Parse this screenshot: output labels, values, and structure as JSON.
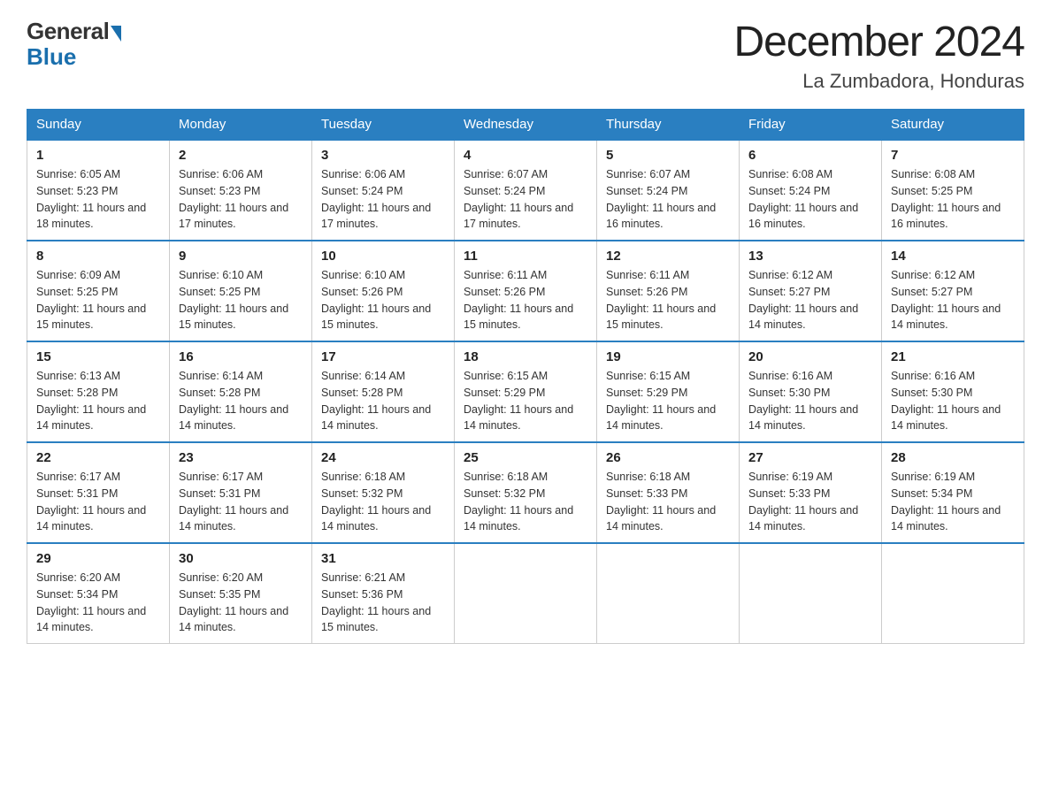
{
  "logo": {
    "general": "General",
    "blue": "Blue"
  },
  "title": "December 2024",
  "location": "La Zumbadora, Honduras",
  "days_header": [
    "Sunday",
    "Monday",
    "Tuesday",
    "Wednesday",
    "Thursday",
    "Friday",
    "Saturday"
  ],
  "weeks": [
    [
      {
        "num": "1",
        "sunrise": "6:05 AM",
        "sunset": "5:23 PM",
        "daylight": "11 hours and 18 minutes."
      },
      {
        "num": "2",
        "sunrise": "6:06 AM",
        "sunset": "5:23 PM",
        "daylight": "11 hours and 17 minutes."
      },
      {
        "num": "3",
        "sunrise": "6:06 AM",
        "sunset": "5:24 PM",
        "daylight": "11 hours and 17 minutes."
      },
      {
        "num": "4",
        "sunrise": "6:07 AM",
        "sunset": "5:24 PM",
        "daylight": "11 hours and 17 minutes."
      },
      {
        "num": "5",
        "sunrise": "6:07 AM",
        "sunset": "5:24 PM",
        "daylight": "11 hours and 16 minutes."
      },
      {
        "num": "6",
        "sunrise": "6:08 AM",
        "sunset": "5:24 PM",
        "daylight": "11 hours and 16 minutes."
      },
      {
        "num": "7",
        "sunrise": "6:08 AM",
        "sunset": "5:25 PM",
        "daylight": "11 hours and 16 minutes."
      }
    ],
    [
      {
        "num": "8",
        "sunrise": "6:09 AM",
        "sunset": "5:25 PM",
        "daylight": "11 hours and 15 minutes."
      },
      {
        "num": "9",
        "sunrise": "6:10 AM",
        "sunset": "5:25 PM",
        "daylight": "11 hours and 15 minutes."
      },
      {
        "num": "10",
        "sunrise": "6:10 AM",
        "sunset": "5:26 PM",
        "daylight": "11 hours and 15 minutes."
      },
      {
        "num": "11",
        "sunrise": "6:11 AM",
        "sunset": "5:26 PM",
        "daylight": "11 hours and 15 minutes."
      },
      {
        "num": "12",
        "sunrise": "6:11 AM",
        "sunset": "5:26 PM",
        "daylight": "11 hours and 15 minutes."
      },
      {
        "num": "13",
        "sunrise": "6:12 AM",
        "sunset": "5:27 PM",
        "daylight": "11 hours and 14 minutes."
      },
      {
        "num": "14",
        "sunrise": "6:12 AM",
        "sunset": "5:27 PM",
        "daylight": "11 hours and 14 minutes."
      }
    ],
    [
      {
        "num": "15",
        "sunrise": "6:13 AM",
        "sunset": "5:28 PM",
        "daylight": "11 hours and 14 minutes."
      },
      {
        "num": "16",
        "sunrise": "6:14 AM",
        "sunset": "5:28 PM",
        "daylight": "11 hours and 14 minutes."
      },
      {
        "num": "17",
        "sunrise": "6:14 AM",
        "sunset": "5:28 PM",
        "daylight": "11 hours and 14 minutes."
      },
      {
        "num": "18",
        "sunrise": "6:15 AM",
        "sunset": "5:29 PM",
        "daylight": "11 hours and 14 minutes."
      },
      {
        "num": "19",
        "sunrise": "6:15 AM",
        "sunset": "5:29 PM",
        "daylight": "11 hours and 14 minutes."
      },
      {
        "num": "20",
        "sunrise": "6:16 AM",
        "sunset": "5:30 PM",
        "daylight": "11 hours and 14 minutes."
      },
      {
        "num": "21",
        "sunrise": "6:16 AM",
        "sunset": "5:30 PM",
        "daylight": "11 hours and 14 minutes."
      }
    ],
    [
      {
        "num": "22",
        "sunrise": "6:17 AM",
        "sunset": "5:31 PM",
        "daylight": "11 hours and 14 minutes."
      },
      {
        "num": "23",
        "sunrise": "6:17 AM",
        "sunset": "5:31 PM",
        "daylight": "11 hours and 14 minutes."
      },
      {
        "num": "24",
        "sunrise": "6:18 AM",
        "sunset": "5:32 PM",
        "daylight": "11 hours and 14 minutes."
      },
      {
        "num": "25",
        "sunrise": "6:18 AM",
        "sunset": "5:32 PM",
        "daylight": "11 hours and 14 minutes."
      },
      {
        "num": "26",
        "sunrise": "6:18 AM",
        "sunset": "5:33 PM",
        "daylight": "11 hours and 14 minutes."
      },
      {
        "num": "27",
        "sunrise": "6:19 AM",
        "sunset": "5:33 PM",
        "daylight": "11 hours and 14 minutes."
      },
      {
        "num": "28",
        "sunrise": "6:19 AM",
        "sunset": "5:34 PM",
        "daylight": "11 hours and 14 minutes."
      }
    ],
    [
      {
        "num": "29",
        "sunrise": "6:20 AM",
        "sunset": "5:34 PM",
        "daylight": "11 hours and 14 minutes."
      },
      {
        "num": "30",
        "sunrise": "6:20 AM",
        "sunset": "5:35 PM",
        "daylight": "11 hours and 14 minutes."
      },
      {
        "num": "31",
        "sunrise": "6:21 AM",
        "sunset": "5:36 PM",
        "daylight": "11 hours and 15 minutes."
      },
      null,
      null,
      null,
      null
    ]
  ]
}
